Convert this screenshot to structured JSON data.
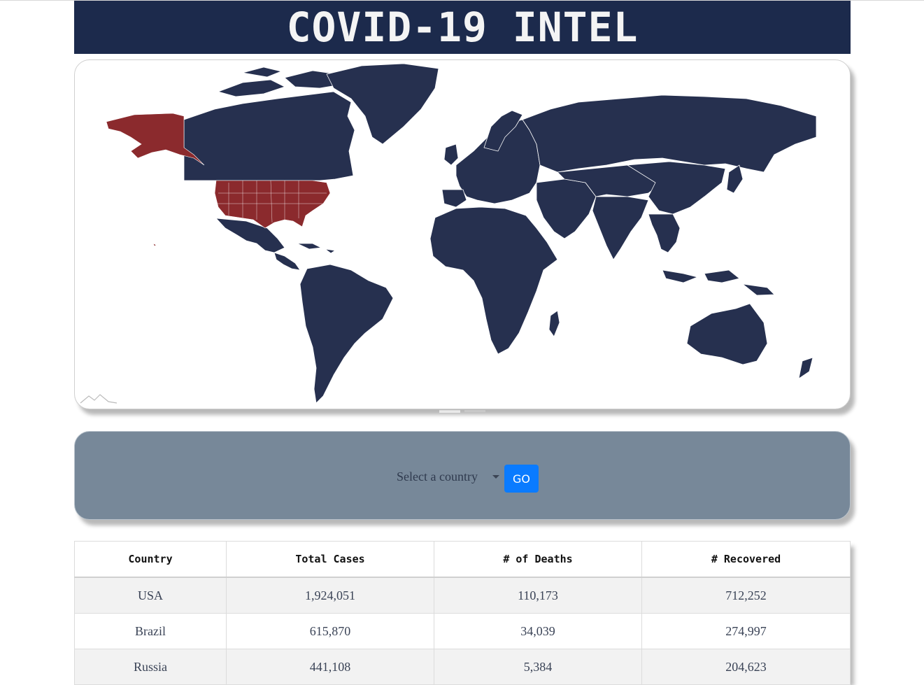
{
  "header": {
    "title": "COVID-19 INTEL"
  },
  "map": {
    "land_color": "#26304f",
    "highlight_color": "#8b2a2d",
    "highlighted_country": "USA",
    "watermark_icon": "mountains-logo-icon",
    "carousel_pages": 2,
    "carousel_active": 1
  },
  "selector": {
    "placeholder": "Select a country",
    "go_label": "GO",
    "button_color": "#0a7bff",
    "panel_color": "#778899"
  },
  "table": {
    "headers": [
      "Country",
      "Total Cases",
      "# of Deaths",
      "# Recovered"
    ],
    "rows": [
      [
        "USA",
        "1,924,051",
        "110,173",
        "712,252"
      ],
      [
        "Brazil",
        "615,870",
        "34,039",
        "274,997"
      ],
      [
        "Russia",
        "441,108",
        "5,384",
        "204,623"
      ]
    ]
  }
}
